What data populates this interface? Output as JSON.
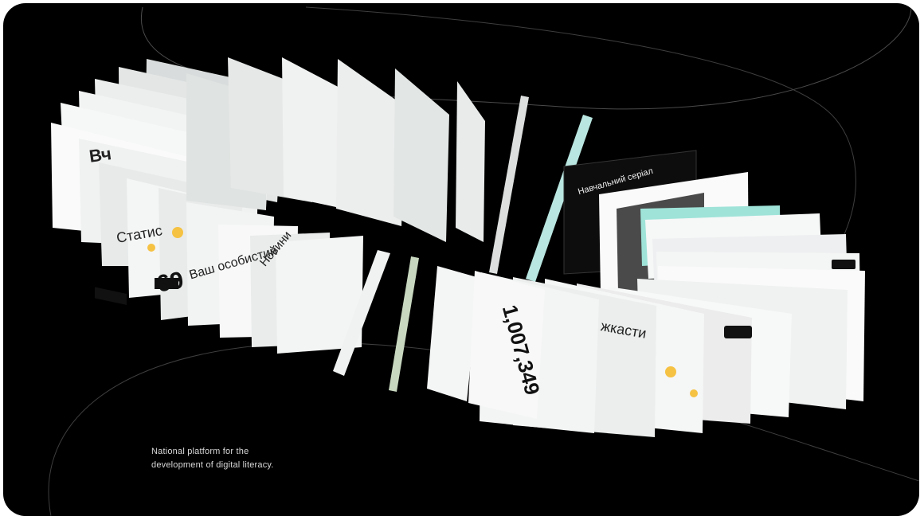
{
  "tagline": {
    "line1": "National platform for the",
    "line2": "development of digital literacy."
  },
  "cards": [
    {
      "text": "Вч"
    },
    {
      "text": "Статис"
    },
    {
      "text": "69"
    },
    {
      "text": "Ваш особистий"
    },
    {
      "text": "Новини"
    },
    {
      "text": "1,007,349"
    },
    {
      "text": "жкасти"
    },
    {
      "text": "Навчальний серіал"
    }
  ],
  "colors": {
    "background": "#000000",
    "card": "#eef0f0",
    "line": "#5a5a5a",
    "teal": "#9fe3d8"
  }
}
